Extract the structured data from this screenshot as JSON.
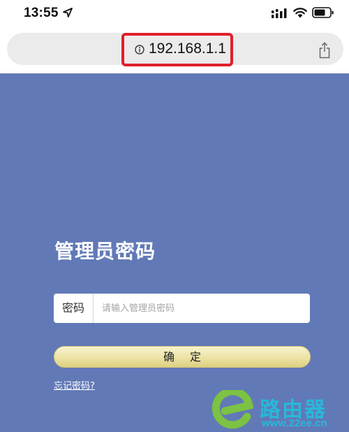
{
  "status_bar": {
    "time": "13:55",
    "icons": [
      "location-arrow-icon",
      "cellular-signal-icon",
      "wifi-icon",
      "battery-icon"
    ]
  },
  "browser": {
    "url": "192.168.1.1",
    "icons": [
      "info-icon",
      "share-icon"
    ],
    "highlight_color": "#e0202b"
  },
  "login": {
    "title": "管理员密码",
    "password_label": "密码",
    "password_placeholder": "请输入管理员密码",
    "password_value": "",
    "confirm_label": "确定",
    "forgot_link": "忘记密码?"
  },
  "watermark": {
    "name": "路由器",
    "url": "www.22ee.cn"
  },
  "colors": {
    "page_background": "#6179b6",
    "button_gradient_top": "#f8f3cf",
    "button_gradient_bottom": "#ddd07f",
    "watermark_accent": "#28b8d9",
    "watermark_green": "#7cc243"
  }
}
